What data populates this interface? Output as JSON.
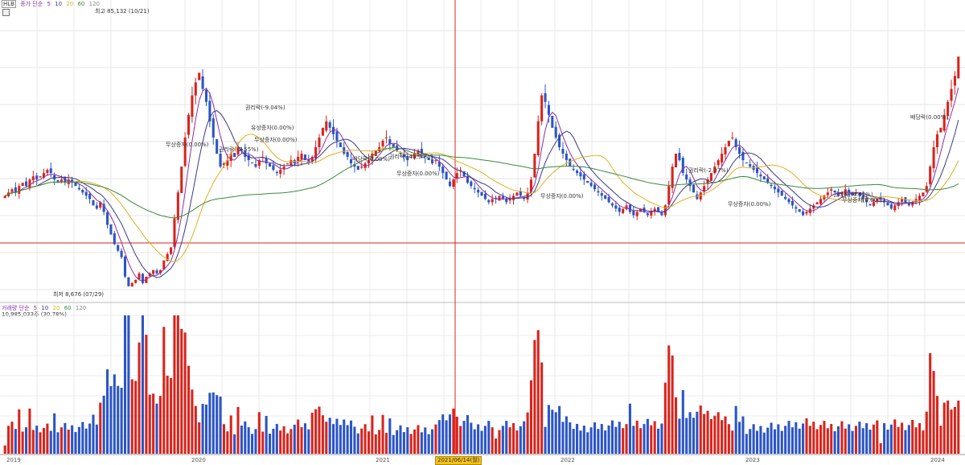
{
  "price_legend": {
    "ticker": "HLB",
    "label": "종가 단순",
    "periods": [
      "5",
      "10",
      "20",
      "60",
      "120"
    ]
  },
  "volume_legend": {
    "label": "거래량 단순",
    "periods": [
      "5",
      "10",
      "20",
      "60",
      "120"
    ],
    "current": "10,985,033주 (30.78%)"
  },
  "annotations": {
    "high": "최고 85,132 (10/21)",
    "low": "최저 8,676 (07/29)",
    "events": [
      "권리락(-9.04%)",
      "유상증자(0.00%)",
      "무상증자(0.00%)",
      "권리락(-2.55%)",
      "무상증자(0.00%)",
      "배당락(0.00%)",
      "권리락(-45.94%)",
      "무상증자(0.00%)",
      "무상증자(0.00%)",
      "권리락(-2.07%)",
      "무상증자(0.00%)",
      "권리락(-4.62%)",
      "무상증자(0.00%)",
      "배당락(0.00%)"
    ]
  },
  "x_axis_labels": [
    "2019",
    "2020",
    "2021",
    "2022",
    "2023",
    "2024"
  ],
  "crosshair_date": "2021/06/14(월)",
  "colors": {
    "up": "#d9241c",
    "down": "#2b55c6",
    "ma5": "#8b2fa8",
    "ma10": "#3a3a8c",
    "ma20": "#3a3a8c",
    "ma60": "#e0b020",
    "ma120": "#3a8a3a",
    "crosshair": "#d9241c"
  },
  "chart_data": {
    "type": "candlestick",
    "interval": "weekly",
    "price_range": [
      5000,
      95000
    ],
    "high": {
      "value": 85132,
      "date": "10/21"
    },
    "low": {
      "value": 8676,
      "date": "07/29"
    },
    "close": [
      37000,
      38000,
      39000,
      38000,
      40000,
      41000,
      40000,
      42000,
      43000,
      42000,
      43000,
      44000,
      45000,
      44000,
      42000,
      41000,
      42000,
      41000,
      42000,
      41000,
      40000,
      39000,
      38000,
      37000,
      36000,
      34000,
      33000,
      35000,
      32000,
      28000,
      25000,
      22000,
      20000,
      18000,
      12000,
      9000,
      10000,
      11000,
      13000,
      10000,
      12000,
      13000,
      14000,
      13000,
      14000,
      17000,
      19000,
      21000,
      30000,
      38000,
      46000,
      55000,
      62000,
      68000,
      72000,
      75000,
      70000,
      66000,
      60000,
      55000,
      50000,
      46000,
      47000,
      48000,
      50000,
      49000,
      52000,
      51000,
      49000,
      48000,
      47000,
      46000,
      48000,
      49000,
      47000,
      46000,
      45000,
      44000,
      45000,
      46000,
      47000,
      48000,
      47000,
      49000,
      50000,
      48000,
      47000,
      49000,
      52000,
      55000,
      58000,
      60000,
      58000,
      56000,
      54000,
      52000,
      50000,
      49000,
      47000,
      46000,
      45000,
      46000,
      47000,
      48000,
      50000,
      51000,
      52000,
      54000,
      55000,
      53000,
      52000,
      51000,
      50000,
      49000,
      48000,
      49000,
      50000,
      51000,
      50000,
      49000,
      48000,
      47000,
      48000,
      46000,
      44000,
      42000,
      40000,
      42000,
      44000,
      45000,
      43000,
      41000,
      40000,
      39000,
      38000,
      37000,
      36000,
      35000,
      36000,
      36000,
      37000,
      36000,
      35000,
      36000,
      37000,
      38000,
      37000,
      36000,
      38000,
      42000,
      50000,
      60000,
      68000,
      66000,
      62000,
      58000,
      55000,
      52000,
      50000,
      48000,
      46000,
      45000,
      44000,
      43000,
      42000,
      41000,
      40000,
      39000,
      38000,
      37000,
      36000,
      35000,
      34000,
      33000,
      32000,
      33000,
      34000,
      32000,
      31000,
      32000,
      33000,
      32000,
      31000,
      32000,
      33000,
      32000,
      31000,
      34000,
      40000,
      46000,
      50000,
      48000,
      44000,
      42000,
      40000,
      38000,
      36000,
      38000,
      40000,
      42000,
      44000,
      46000,
      48000,
      50000,
      52000,
      54000,
      55000,
      52000,
      50000,
      48000,
      47000,
      46000,
      45000,
      44000,
      43000,
      42000,
      41000,
      40000,
      39000,
      38000,
      37000,
      36000,
      35000,
      34000,
      33000,
      32000,
      31000,
      32000,
      33000,
      34000,
      35000,
      36000,
      37000,
      38000,
      39000,
      38000,
      37000,
      38000,
      39000,
      38000,
      37000,
      38000,
      37000,
      36000,
      35000,
      34000,
      35000,
      36000,
      36000,
      35000,
      34000,
      33000,
      34000,
      35000,
      36000,
      35000,
      34000,
      35000,
      36000,
      37000,
      38000,
      40000,
      46000,
      52000,
      56000,
      58000,
      62000,
      66000,
      70000,
      74000,
      80000
    ],
    "volume_max": 22000000
  }
}
